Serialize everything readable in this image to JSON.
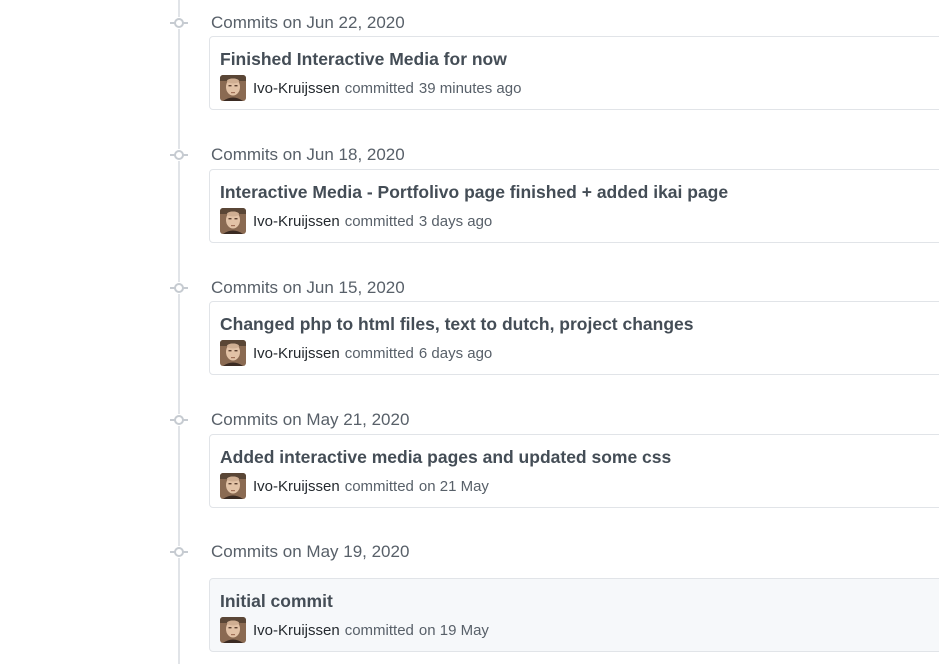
{
  "groups": [
    {
      "date": "Commits on Jun 22, 2020",
      "commit": {
        "title": "Finished Interactive Media for now",
        "author": "Ivo-Kruijssen",
        "verb": "committed",
        "when": "39 minutes ago"
      }
    },
    {
      "date": "Commits on Jun 18, 2020",
      "commit": {
        "title": "Interactive Media - Portfolivo page finished + added ikai page",
        "author": "Ivo-Kruijssen",
        "verb": "committed",
        "when": "3 days ago"
      }
    },
    {
      "date": "Commits on Jun 15, 2020",
      "commit": {
        "title": "Changed php to html files, text to dutch, project changes",
        "author": "Ivo-Kruijssen",
        "verb": "committed",
        "when": "6 days ago"
      }
    },
    {
      "date": "Commits on May 21, 2020",
      "commit": {
        "title": "Added interactive media pages and updated some css",
        "author": "Ivo-Kruijssen",
        "verb": "committed",
        "when": "on 21 May"
      }
    },
    {
      "date": "Commits on May 19, 2020",
      "commit": {
        "title": "Initial commit",
        "author": "Ivo-Kruijssen",
        "verb": "committed",
        "when": "on 19 May"
      }
    }
  ],
  "colors": {
    "timeline": "#e1e4e8",
    "date_text": "#586069",
    "title_text": "#444d56",
    "highlight_bg": "#f6f8fa"
  },
  "icons": {
    "commit_node": "git-commit-icon",
    "avatar": "user-avatar"
  }
}
